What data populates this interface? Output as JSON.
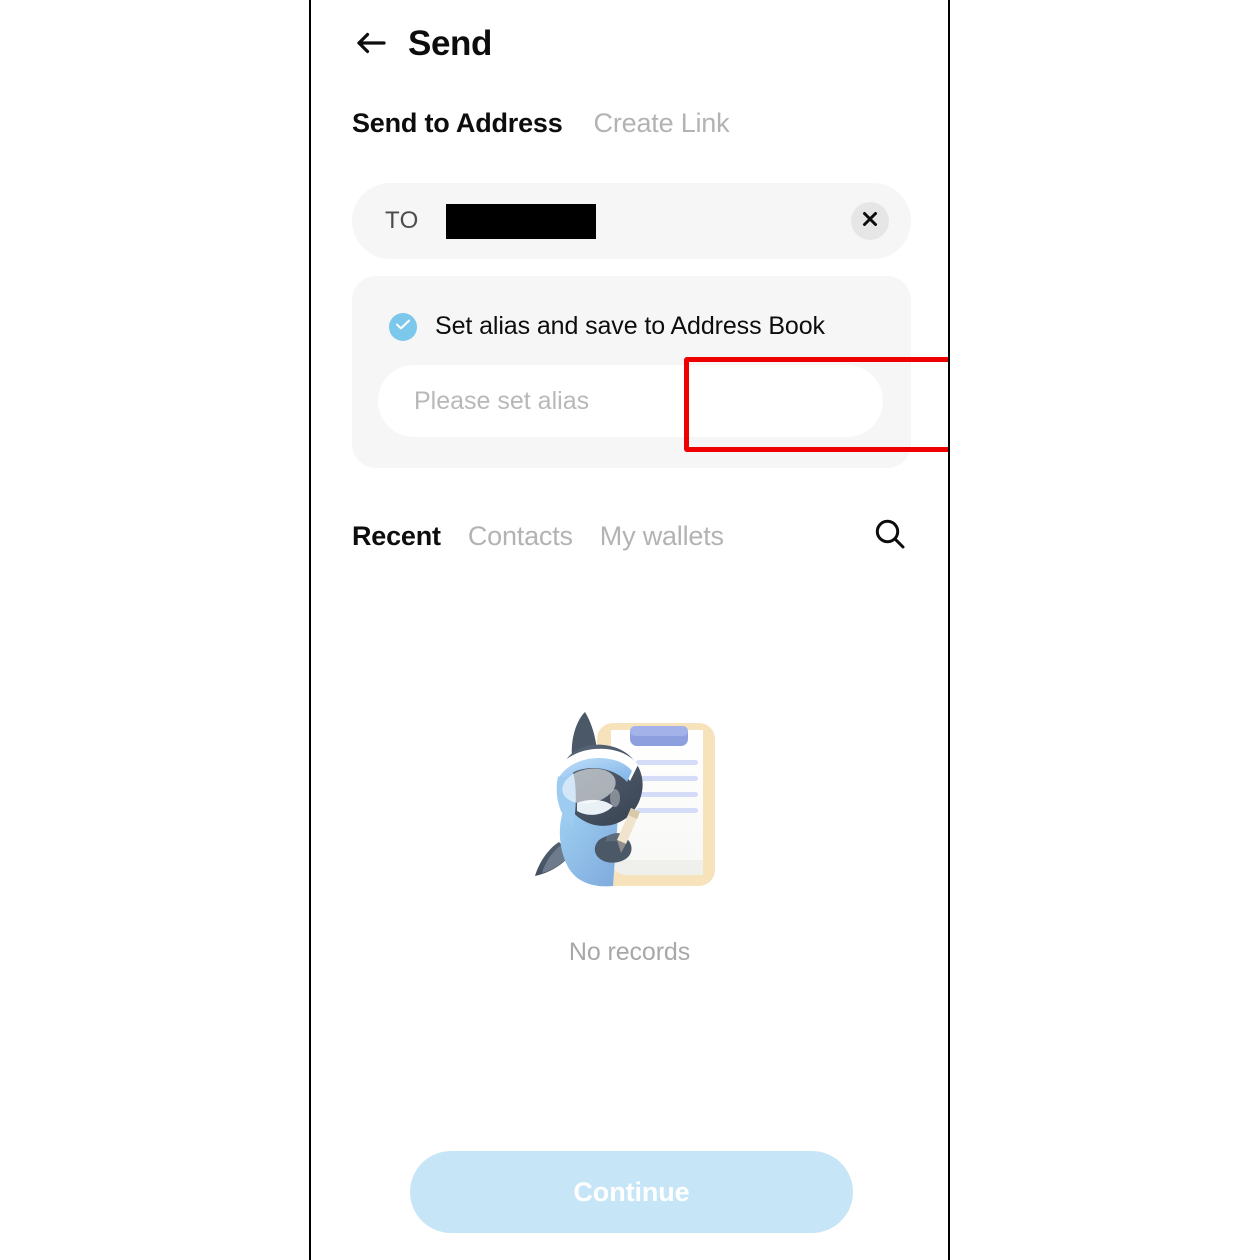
{
  "header": {
    "back_icon": "arrow-left-icon",
    "title": "Send"
  },
  "mode_tabs": [
    {
      "label": "Send to Address",
      "active": true
    },
    {
      "label": "Create Link",
      "active": false
    }
  ],
  "to_field": {
    "label": "TO",
    "value_redacted": true,
    "clear_icon": "close-icon"
  },
  "alias_card": {
    "checkbox_checked": true,
    "checkbox_icon": "check-icon",
    "checkbox_label": "Set alias and save to Address Book",
    "input_value": "",
    "input_placeholder": "Please set alias"
  },
  "annotation": {
    "target": "alias-input",
    "color": "#ee0000"
  },
  "list_tabs": [
    {
      "label": "Recent",
      "active": true
    },
    {
      "label": "Contacts",
      "active": false
    },
    {
      "label": "My wallets",
      "active": false
    }
  ],
  "search": {
    "icon": "search-icon"
  },
  "empty_state": {
    "illustration": "mascot-with-clipboard-illustration",
    "text": "No records"
  },
  "footer": {
    "continue_label": "Continue",
    "continue_enabled": false
  },
  "colors": {
    "accent": "#7cc7ec",
    "button_disabled": "#c6e6f8",
    "field_background": "#f6f6f6",
    "muted_text": "#b3b3b3",
    "annotation": "#ee0000"
  }
}
